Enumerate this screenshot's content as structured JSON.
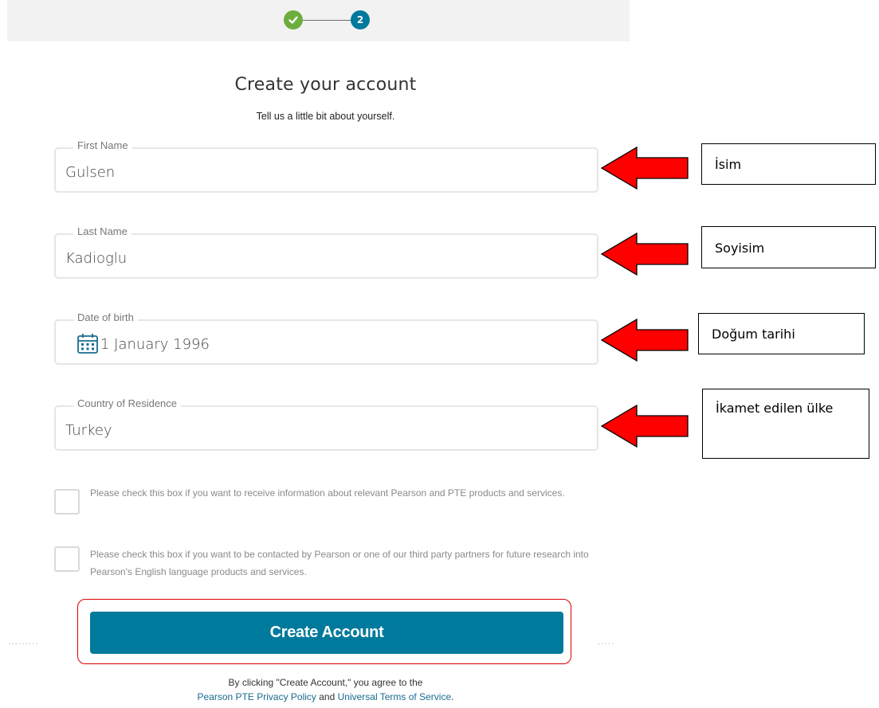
{
  "stepper": {
    "step1_icon": "check-icon",
    "step2_label": "2"
  },
  "header": {
    "title": "Create your account",
    "subtitle": "Tell us a little bit about yourself."
  },
  "form": {
    "first_name": {
      "label": "First Name",
      "value": "Gulsen"
    },
    "last_name": {
      "label": "Last Name",
      "value": "Kadioglu"
    },
    "dob": {
      "label": "Date of birth",
      "value": "1 January 1996",
      "icon": "calendar-icon"
    },
    "country": {
      "label": "Country of Residence",
      "value": "Turkey"
    },
    "checkbox_marketing": {
      "text": "Please check this box if you want to receive information about relevant Pearson and PTE products and services.",
      "checked": false
    },
    "checkbox_research": {
      "text": "Please check this box if you want to be contacted by Pearson or one of our third party partners for future research into Pearson's English language products and services.",
      "checked": false
    },
    "submit_label": "Create Account"
  },
  "legal": {
    "line1": "By clicking \"Create Account,\" you agree to the",
    "privacy_link": "Pearson PTE Privacy Policy",
    "and": " and ",
    "terms_link": "Universal Terms of Service",
    "period": "."
  },
  "annotations": [
    {
      "text": "İsim"
    },
    {
      "text": "Soyisim"
    },
    {
      "text": "Doğum tarihi"
    },
    {
      "text": "İkamet edilen ülke"
    }
  ],
  "colors": {
    "accent": "#007a9c",
    "success": "#6cae3e",
    "annotation_arrow": "#ff0000",
    "highlight_border": "#dd0000"
  }
}
